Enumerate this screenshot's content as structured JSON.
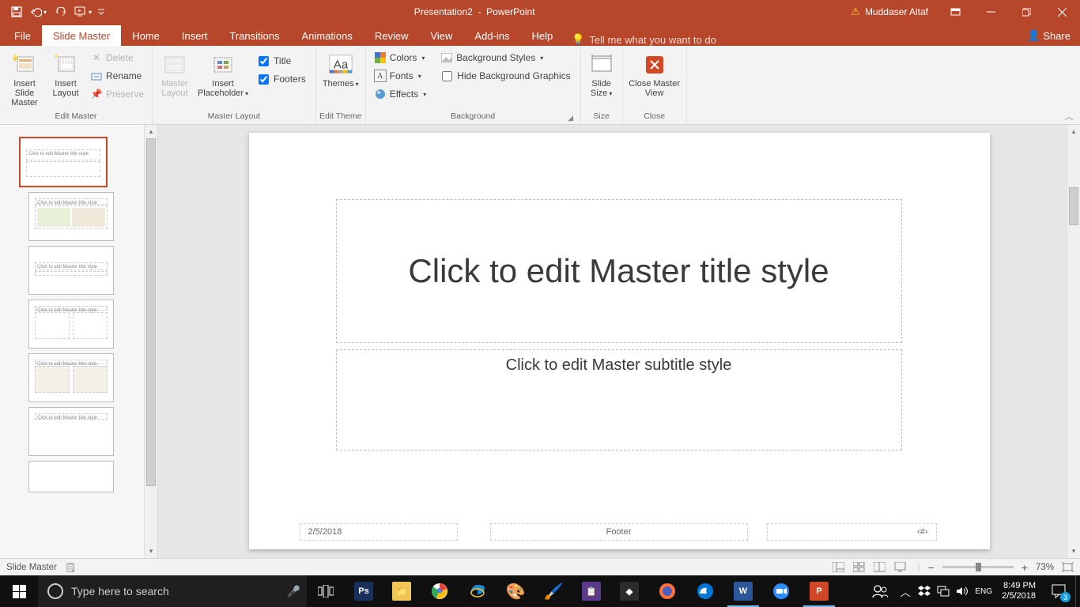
{
  "titlebar": {
    "document": "Presentation2",
    "app": "PowerPoint",
    "user": "Muddaser Altaf"
  },
  "tabs": {
    "file": "File",
    "slidemaster": "Slide Master",
    "home": "Home",
    "insert": "Insert",
    "transitions": "Transitions",
    "animations": "Animations",
    "review": "Review",
    "view": "View",
    "addins": "Add-ins",
    "help": "Help",
    "tellme": "Tell me what you want to do",
    "share": "Share"
  },
  "ribbon": {
    "editmaster": {
      "insert_slide_master": "Insert Slide Master",
      "insert_layout": "Insert Layout",
      "delete": "Delete",
      "rename": "Rename",
      "preserve": "Preserve",
      "group": "Edit Master"
    },
    "masterlayout": {
      "master_layout": "Master Layout",
      "insert_placeholder": "Insert Placeholder",
      "title": "Title",
      "footers": "Footers",
      "group": "Master Layout"
    },
    "edittheme": {
      "themes": "Themes",
      "group": "Edit Theme"
    },
    "background": {
      "colors": "Colors",
      "fonts": "Fonts",
      "effects": "Effects",
      "bgstyles": "Background Styles",
      "hidebg": "Hide Background Graphics",
      "group": "Background"
    },
    "size": {
      "slide_size": "Slide Size",
      "group": "Size"
    },
    "close": {
      "close_master": "Close Master View",
      "group": "Close"
    }
  },
  "slide": {
    "title_placeholder": "Click to edit Master title style",
    "subtitle_placeholder": "Click to edit Master subtitle style",
    "date": "2/5/2018",
    "footer": "Footer",
    "slidenum": "‹#›"
  },
  "status": {
    "mode": "Slide Master",
    "zoom": "73%"
  },
  "taskbar": {
    "search_placeholder": "Type here to search",
    "time": "8:49 PM",
    "date": "2/5/2018",
    "notif_count": "3"
  }
}
